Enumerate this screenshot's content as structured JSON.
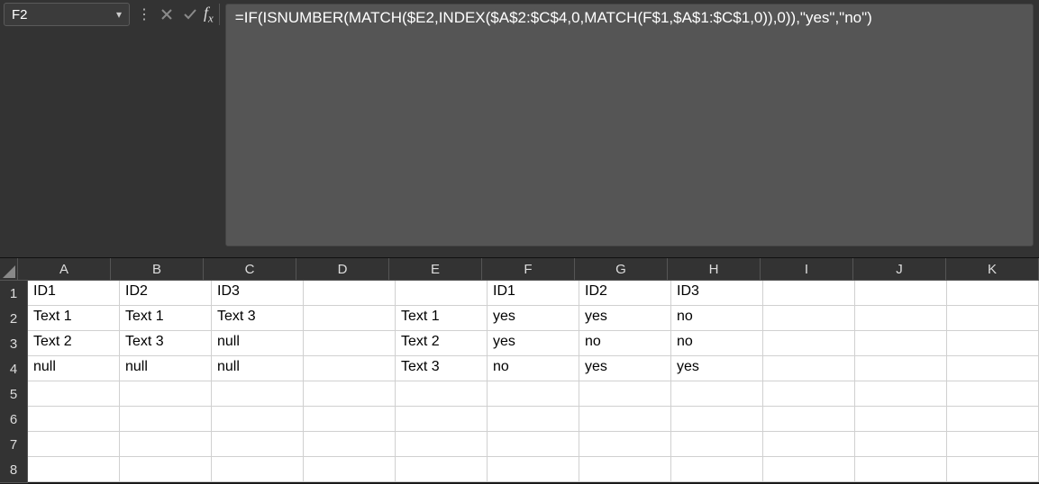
{
  "name_box": "F2",
  "formula": "=IF(ISNUMBER(MATCH($E2,INDEX($A$2:$C$4,0,MATCH(F$1,$A$1:$C$1,0)),0)),\"yes\",\"no\")",
  "columns": [
    "A",
    "B",
    "C",
    "D",
    "E",
    "F",
    "G",
    "H",
    "I",
    "J",
    "K"
  ],
  "row_headers": [
    "1",
    "2",
    "3",
    "4",
    "5",
    "6",
    "7",
    "8"
  ],
  "cells": {
    "r1": {
      "A": "ID1",
      "B": "ID2",
      "C": "ID3",
      "D": "",
      "E": "",
      "F": "ID1",
      "G": "ID2",
      "H": "ID3",
      "I": "",
      "J": "",
      "K": ""
    },
    "r2": {
      "A": "Text 1",
      "B": "Text 1",
      "C": "Text 3",
      "D": "",
      "E": "Text 1",
      "F": "yes",
      "G": "yes",
      "H": "no",
      "I": "",
      "J": "",
      "K": ""
    },
    "r3": {
      "A": "Text 2",
      "B": "Text 3",
      "C": "null",
      "D": "",
      "E": "Text 2",
      "F": "yes",
      "G": "no",
      "H": "no",
      "I": "",
      "J": "",
      "K": ""
    },
    "r4": {
      "A": "null",
      "B": "null",
      "C": "null",
      "D": "",
      "E": "Text 3",
      "F": "no",
      "G": "yes",
      "H": "yes",
      "I": "",
      "J": "",
      "K": ""
    },
    "r5": {
      "A": "",
      "B": "",
      "C": "",
      "D": "",
      "E": "",
      "F": "",
      "G": "",
      "H": "",
      "I": "",
      "J": "",
      "K": ""
    },
    "r6": {
      "A": "",
      "B": "",
      "C": "",
      "D": "",
      "E": "",
      "F": "",
      "G": "",
      "H": "",
      "I": "",
      "J": "",
      "K": ""
    },
    "r7": {
      "A": "",
      "B": "",
      "C": "",
      "D": "",
      "E": "",
      "F": "",
      "G": "",
      "H": "",
      "I": "",
      "J": "",
      "K": ""
    },
    "r8": {
      "A": "",
      "B": "",
      "C": "",
      "D": "",
      "E": "",
      "F": "",
      "G": "",
      "H": "",
      "I": "",
      "J": "",
      "K": ""
    }
  }
}
